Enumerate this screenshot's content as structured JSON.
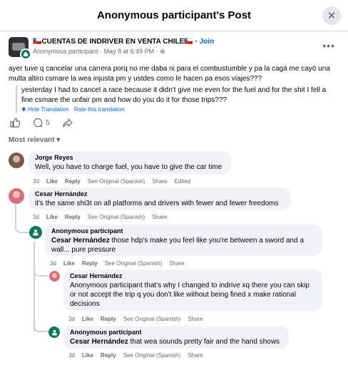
{
  "header": {
    "title": "Anonymous participant's Post",
    "close_icon": "close-icon"
  },
  "post": {
    "group_name": "🇨🇱CUENTAS DE INDRIVER EN VENTA CHILE🇨🇱",
    "join": "Join",
    "author": "Anonymous participant",
    "date": "May 8 at 6:49 PM",
    "sep": "·",
    "text": "ayer tuve q cancelar una carrera porq no me daba ni para el combustumble y pa la cagá me cayó una multa altiro csmare la wea injusta pm y ustdes como le hacen pa esos viajes???",
    "translation": "yesterday I had to cancel a race because it didn't give me even for the fuel and for the shit I fell a fine csmare the unfair pm and how do you do it for those trips???",
    "hide_translation": "Hide Translation",
    "rate_translation": "Rate this translation",
    "comment_count": "5"
  },
  "filter": {
    "label": "Most relevant",
    "chevron": "chevron-down-icon"
  },
  "comments": [
    {
      "author": "Jorge Reyes",
      "text": "Well, you have to charge fuel, you have to give the car time",
      "time": "3d",
      "like": "Like",
      "reply": "Reply",
      "see_original": "See Original (Spanish)",
      "share": "Share",
      "edited": "Edited"
    },
    {
      "author": "Cesar Hernández",
      "text": "it's the same shi3t on all platforms and drivers with fewer and fewer freedoms",
      "time": "3d",
      "like": "Like",
      "reply": "Reply",
      "see_original": "See Original (Spanish)",
      "share": "Share"
    },
    {
      "author": "Anonymous participant",
      "mention": "Cesar Hernández",
      "text": "those hdp's make you feel like you're between a sword and a wall... pure pressure",
      "time": "3d",
      "like": "Like",
      "reply": "Reply",
      "see_original": "See Original (Spanish)",
      "share": "Share"
    },
    {
      "author": "Cesar Hernández",
      "text": "Anonymous participant that's why I changed to indrive xq there you can skip or not accept the trip q you don't like without being fined x make rational decisions",
      "time": "3d",
      "like": "Like",
      "reply": "Reply",
      "see_original": "See Original (Spanish)",
      "share": "Share"
    },
    {
      "author": "Anonymous participant",
      "mention": "Cesar Hernández",
      "text": "that wea sounds pretty fair and the hand shows",
      "time": "3d",
      "like": "Like",
      "reply": "Reply",
      "see_original": "See Original (Spanish)",
      "share": "Share"
    }
  ],
  "colors": {
    "link": "#0064d1",
    "anon": "#0a7a52",
    "bubble": "#f0f2f5"
  }
}
